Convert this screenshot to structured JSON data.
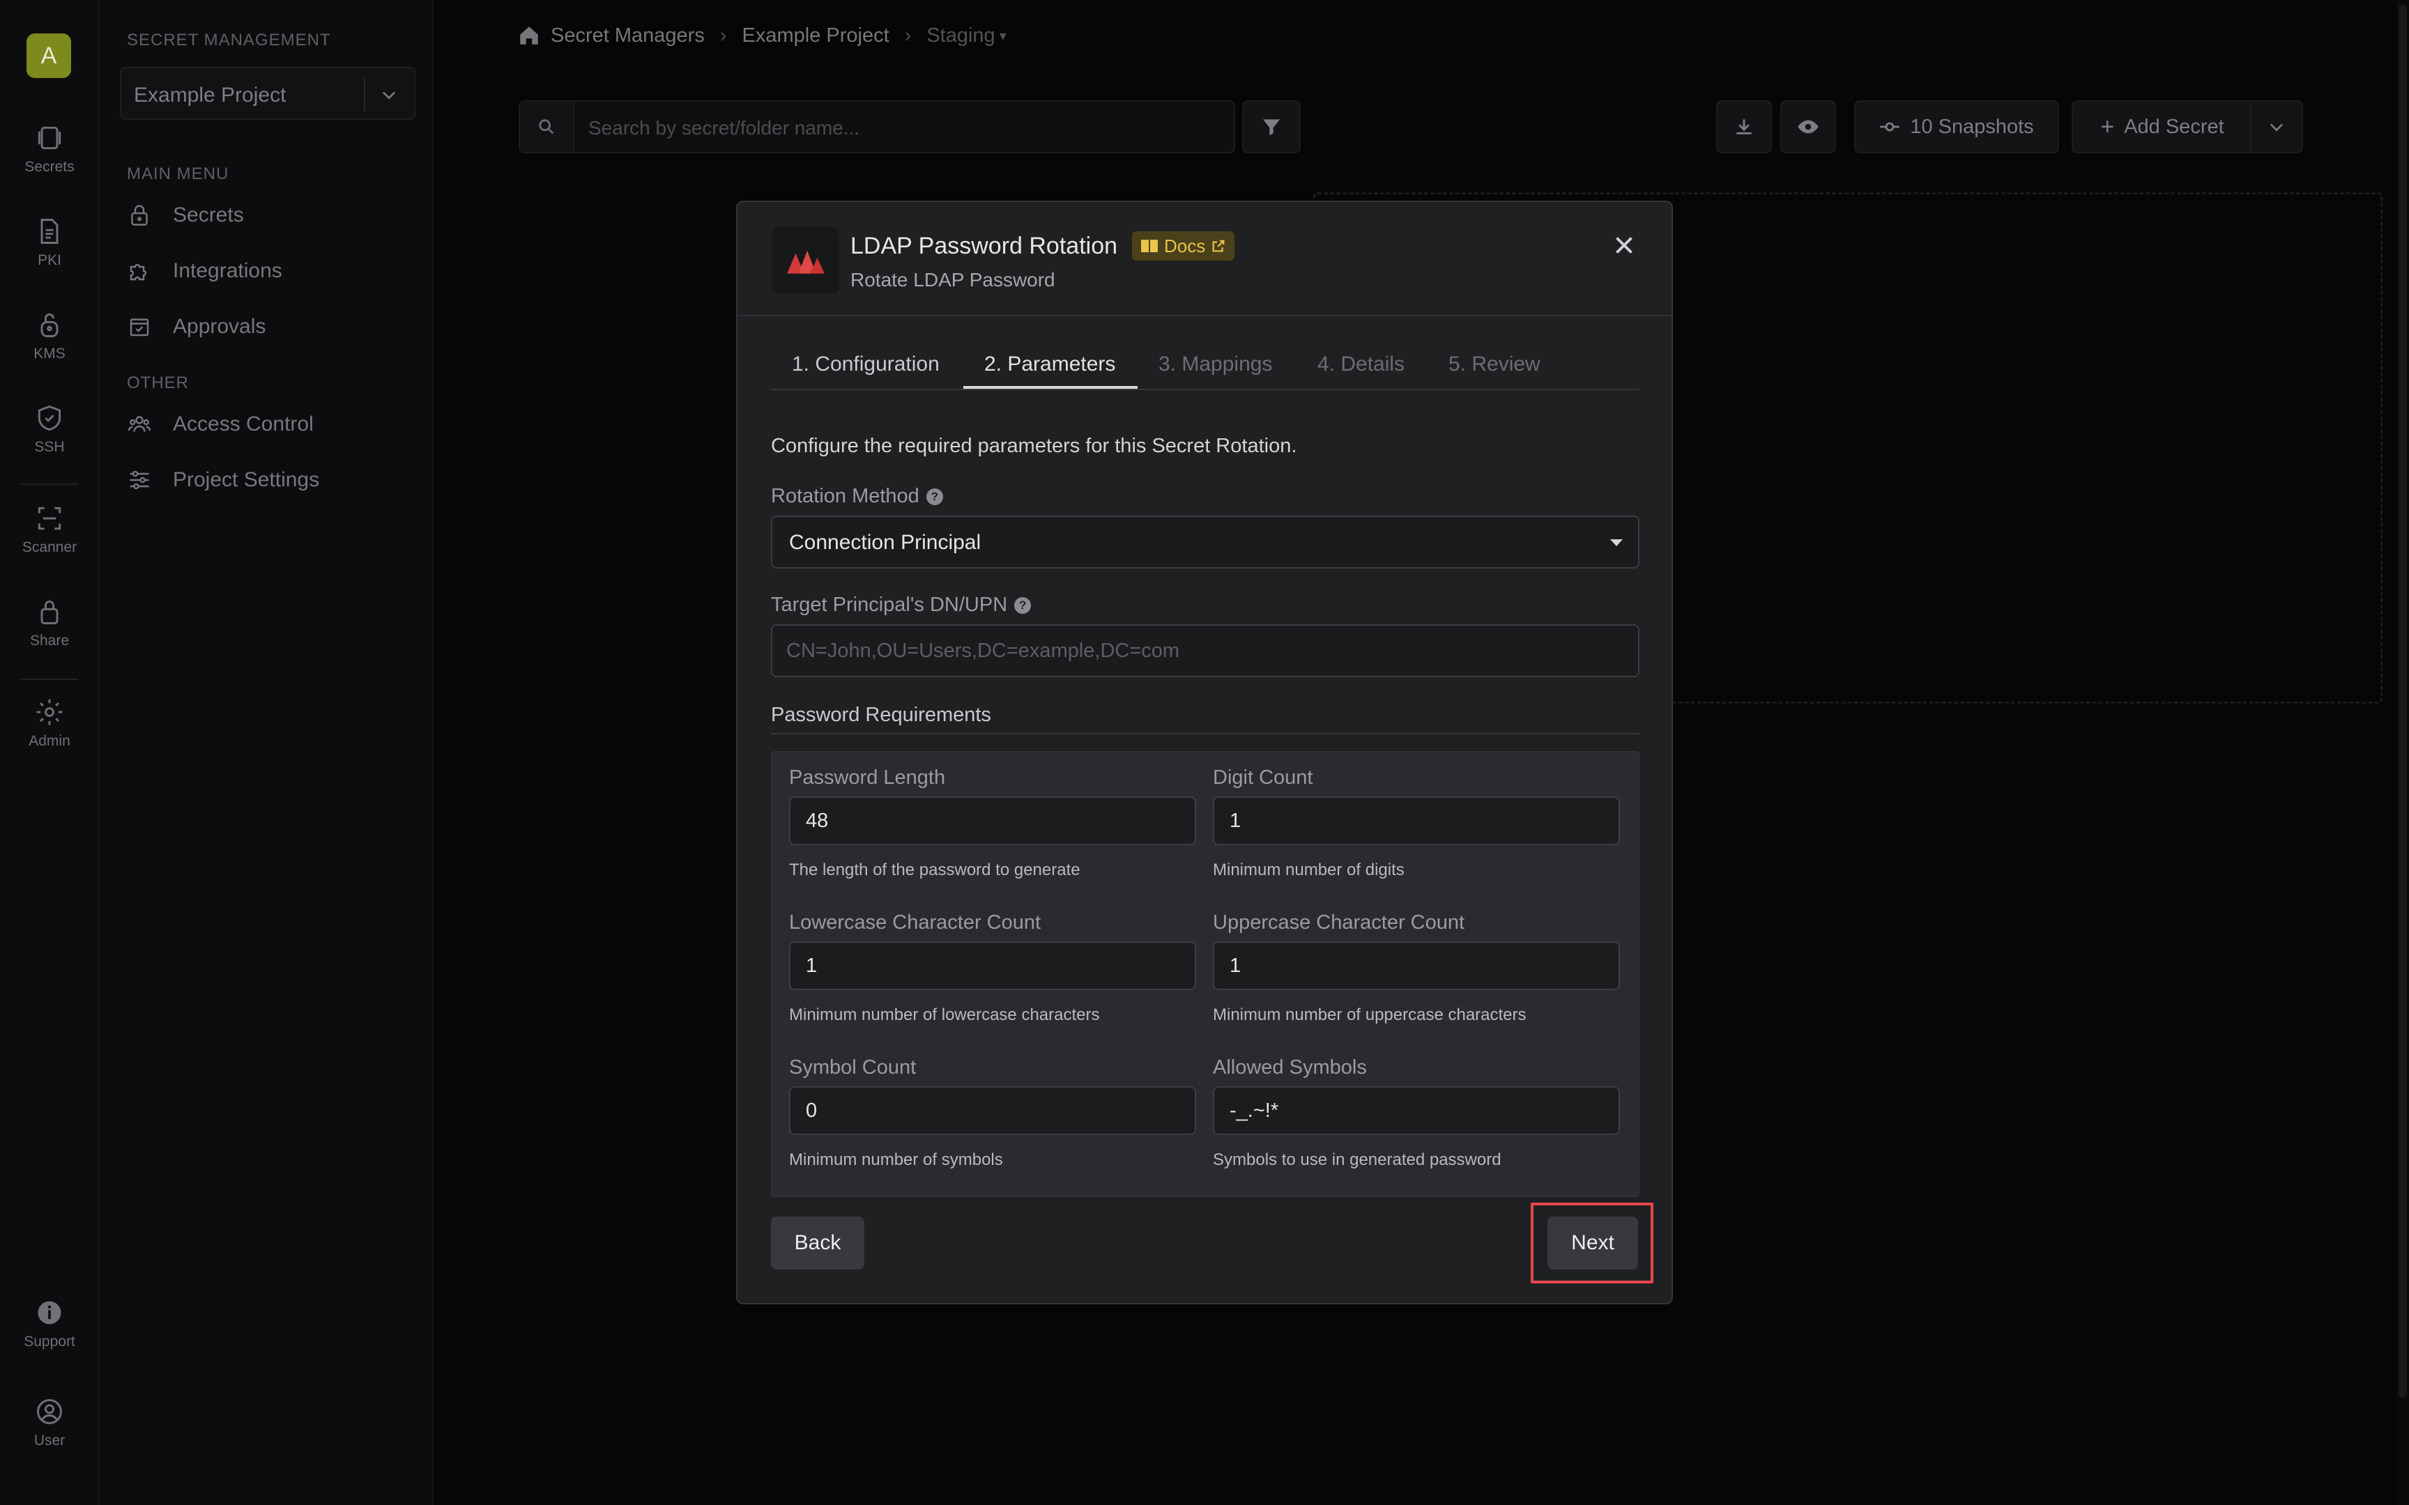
{
  "rail": {
    "avatar": "A",
    "items": [
      {
        "label": "Secrets",
        "icon": "secrets-icon"
      },
      {
        "label": "PKI",
        "icon": "document-icon"
      },
      {
        "label": "KMS",
        "icon": "lock-icon"
      },
      {
        "label": "SSH",
        "icon": "shield-icon"
      },
      {
        "label": "Scanner",
        "icon": "scanner-icon"
      },
      {
        "label": "Share",
        "icon": "lock-icon"
      },
      {
        "label": "Admin",
        "icon": "gear-icon"
      }
    ],
    "bottom": [
      {
        "label": "Support",
        "icon": "info-icon"
      },
      {
        "label": "User",
        "icon": "user-icon"
      }
    ]
  },
  "sidebar": {
    "section_title": "SECRET MANAGEMENT",
    "project": "Example Project",
    "main_menu_title": "MAIN MENU",
    "main_menu": [
      {
        "label": "Secrets",
        "icon": "lock-icon"
      },
      {
        "label": "Integrations",
        "icon": "puzzle-icon"
      },
      {
        "label": "Approvals",
        "icon": "check-square-icon"
      }
    ],
    "other_title": "OTHER",
    "other": [
      {
        "label": "Access Control",
        "icon": "users-icon"
      },
      {
        "label": "Project Settings",
        "icon": "sliders-icon"
      }
    ]
  },
  "breadcrumb": {
    "home": "Secret Managers",
    "project": "Example Project",
    "env": "Staging"
  },
  "toolbar": {
    "search_placeholder": "Search by secret/folder name...",
    "snapshots": "10 Snapshots",
    "add_secret": "Add Secret"
  },
  "modal": {
    "title": "LDAP Password Rotation",
    "docs": "Docs",
    "subtitle": "Rotate LDAP Password",
    "tabs": [
      "1. Configuration",
      "2. Parameters",
      "3. Mappings",
      "4. Details",
      "5. Review"
    ],
    "active_tab": 1,
    "intro": "Configure the required parameters for this Secret Rotation.",
    "rotation_method_label": "Rotation Method",
    "rotation_method_value": "Connection Principal",
    "target_label": "Target Principal's DN/UPN",
    "target_placeholder": "CN=John,OU=Users,DC=example,DC=com",
    "password_requirements": "Password Requirements",
    "fields": {
      "length": {
        "label": "Password Length",
        "value": "48",
        "hint": "The length of the password to generate"
      },
      "digits": {
        "label": "Digit Count",
        "value": "1",
        "hint": "Minimum number of digits"
      },
      "lower": {
        "label": "Lowercase Character Count",
        "value": "1",
        "hint": "Minimum number of lowercase characters"
      },
      "upper": {
        "label": "Uppercase Character Count",
        "value": "1",
        "hint": "Minimum number of uppercase characters"
      },
      "symbols": {
        "label": "Symbol Count",
        "value": "0",
        "hint": "Minimum number of symbols"
      },
      "allowed": {
        "label": "Allowed Symbols",
        "value": "-_.~!*",
        "hint": "Symbols to use in generated password"
      }
    },
    "back": "Back",
    "next": "Next"
  },
  "colors": {
    "accent_red": "#e5484d",
    "docs_yellow": "#e7c54a",
    "avatar": "#7d8a1e"
  }
}
